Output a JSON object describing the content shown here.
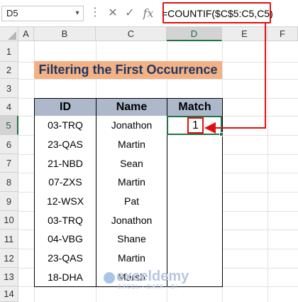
{
  "formula_bar": {
    "name_box": "D5",
    "dots": "⋮",
    "cancel_icon": "✕",
    "enter_icon": "✓",
    "fx_label": "fx",
    "formula": "=COUNTIF($C$5:C5,C5)"
  },
  "columns": [
    "A",
    "B",
    "C",
    "D",
    "E",
    "F"
  ],
  "selected_column": "D",
  "rows": [
    "1",
    "2",
    "3",
    "4",
    "5",
    "6",
    "7",
    "8",
    "9",
    "10",
    "11",
    "12",
    "13",
    "14"
  ],
  "selected_row": "5",
  "title": "Filtering the First Occurrence",
  "table": {
    "headers": [
      "ID",
      "Name",
      "Match"
    ],
    "rows": [
      [
        "03-TRQ",
        "Jonathon",
        "1"
      ],
      [
        "23-QAS",
        "Martin",
        ""
      ],
      [
        "21-NBD",
        "Sean",
        ""
      ],
      [
        "07-ZXS",
        "Martin",
        ""
      ],
      [
        "12-WSX",
        "Pat",
        ""
      ],
      [
        "03-TRQ",
        "Jonathon",
        ""
      ],
      [
        "04-VBG",
        "Shane",
        ""
      ],
      [
        "23-QAS",
        "Martin",
        ""
      ],
      [
        "18-DHA",
        "Marsh",
        ""
      ]
    ]
  },
  "annotation_color": "#e01010",
  "selection_color": "#217346",
  "watermark": {
    "name": "exceldemy",
    "tagline": "EXCEL · DATA · BI"
  }
}
